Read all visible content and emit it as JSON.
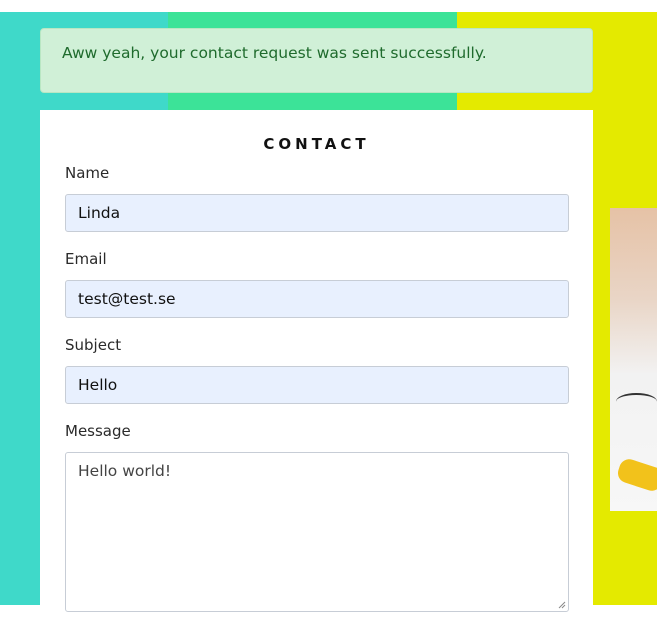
{
  "alert": {
    "message": "Aww yeah, your contact request was sent successfully."
  },
  "form": {
    "title": "CONTACT",
    "name": {
      "label": "Name",
      "value": "Linda"
    },
    "email": {
      "label": "Email",
      "value": "test@test.se"
    },
    "subject": {
      "label": "Subject",
      "value": "Hello"
    },
    "message": {
      "label": "Message",
      "value": "Hello world!"
    }
  },
  "colors": {
    "teal": "#3fd9c9",
    "green": "#3ce398",
    "yellow": "#e4ea00",
    "alert_bg": "#d0f0d7",
    "alert_text": "#1f6b2d",
    "input_bg": "#e8f0fe"
  },
  "icons": {
    "resize": "resize-grip-icon"
  }
}
